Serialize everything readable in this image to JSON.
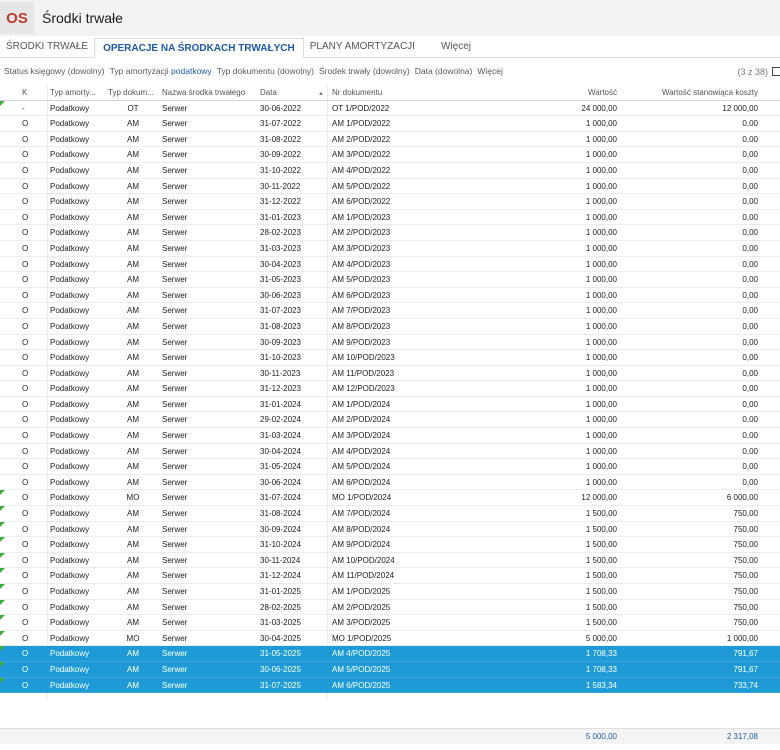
{
  "app": {
    "badge": "OS",
    "title": "Środki trwałe"
  },
  "tabs": [
    {
      "label": "ŚRODKI TRWAŁE",
      "active": false
    },
    {
      "label": "OPERACJE NA ŚRODKACH TRWAŁYCH",
      "active": true
    },
    {
      "label": "PLANY AMORTYZACJI",
      "active": false
    }
  ],
  "tabs_more": "Więcej",
  "filters": [
    {
      "label": "Status księgowy (dowolny)",
      "value": ""
    },
    {
      "label": "Typ amortyzacji ",
      "value": "podatkowy"
    },
    {
      "label": "Typ dokumentu (dowolny)",
      "value": ""
    },
    {
      "label": "Środek trwały (dowolny)",
      "value": ""
    },
    {
      "label": "Data (dowolna)",
      "value": ""
    },
    {
      "label": "Więcej",
      "value": ""
    }
  ],
  "record_count": "(3 z 38)",
  "columns": {
    "k": "K",
    "typ_amortyzacji": "Typ amorty...",
    "typ_dokumentu": "Typ dokum...",
    "nazwa": "Nazwa środka trwałego",
    "data": "Data",
    "nr": "Nr dokumentu",
    "wartosc": "Wartość",
    "wartosc_koszty": "Wartość stanowiąca koszty"
  },
  "rows": [
    {
      "k": "-",
      "ta": "Podatkowy",
      "td": "OT",
      "nz": "Serwer",
      "dt": "30-06-2022",
      "nr": "OT 1/POD/2022",
      "wa": "24 000,00",
      "wk": "12 000,00",
      "mark": true,
      "sel": false
    },
    {
      "k": "O",
      "ta": "Podatkowy",
      "td": "AM",
      "nz": "Serwer",
      "dt": "31-07-2022",
      "nr": "AM 1/POD/2022",
      "wa": "1 000,00",
      "wk": "0,00",
      "mark": false,
      "sel": false
    },
    {
      "k": "O",
      "ta": "Podatkowy",
      "td": "AM",
      "nz": "Serwer",
      "dt": "31-08-2022",
      "nr": "AM 2/POD/2022",
      "wa": "1 000,00",
      "wk": "0,00",
      "mark": false,
      "sel": false
    },
    {
      "k": "O",
      "ta": "Podatkowy",
      "td": "AM",
      "nz": "Serwer",
      "dt": "30-09-2022",
      "nr": "AM 3/POD/2022",
      "wa": "1 000,00",
      "wk": "0,00",
      "mark": false,
      "sel": false
    },
    {
      "k": "O",
      "ta": "Podatkowy",
      "td": "AM",
      "nz": "Serwer",
      "dt": "31-10-2022",
      "nr": "AM 4/POD/2022",
      "wa": "1 000,00",
      "wk": "0,00",
      "mark": false,
      "sel": false
    },
    {
      "k": "O",
      "ta": "Podatkowy",
      "td": "AM",
      "nz": "Serwer",
      "dt": "30-11-2022",
      "nr": "AM 5/POD/2022",
      "wa": "1 000,00",
      "wk": "0,00",
      "mark": false,
      "sel": false
    },
    {
      "k": "O",
      "ta": "Podatkowy",
      "td": "AM",
      "nz": "Serwer",
      "dt": "31-12-2022",
      "nr": "AM 6/POD/2022",
      "wa": "1 000,00",
      "wk": "0,00",
      "mark": false,
      "sel": false
    },
    {
      "k": "O",
      "ta": "Podatkowy",
      "td": "AM",
      "nz": "Serwer",
      "dt": "31-01-2023",
      "nr": "AM 1/POD/2023",
      "wa": "1 000,00",
      "wk": "0,00",
      "mark": false,
      "sel": false
    },
    {
      "k": "O",
      "ta": "Podatkowy",
      "td": "AM",
      "nz": "Serwer",
      "dt": "28-02-2023",
      "nr": "AM 2/POD/2023",
      "wa": "1 000,00",
      "wk": "0,00",
      "mark": false,
      "sel": false
    },
    {
      "k": "O",
      "ta": "Podatkowy",
      "td": "AM",
      "nz": "Serwer",
      "dt": "31-03-2023",
      "nr": "AM 3/POD/2023",
      "wa": "1 000,00",
      "wk": "0,00",
      "mark": false,
      "sel": false
    },
    {
      "k": "O",
      "ta": "Podatkowy",
      "td": "AM",
      "nz": "Serwer",
      "dt": "30-04-2023",
      "nr": "AM 4/POD/2023",
      "wa": "1 000,00",
      "wk": "0,00",
      "mark": false,
      "sel": false
    },
    {
      "k": "O",
      "ta": "Podatkowy",
      "td": "AM",
      "nz": "Serwer",
      "dt": "31-05-2023",
      "nr": "AM 5/POD/2023",
      "wa": "1 000,00",
      "wk": "0,00",
      "mark": false,
      "sel": false
    },
    {
      "k": "O",
      "ta": "Podatkowy",
      "td": "AM",
      "nz": "Serwer",
      "dt": "30-06-2023",
      "nr": "AM 6/POD/2023",
      "wa": "1 000,00",
      "wk": "0,00",
      "mark": false,
      "sel": false
    },
    {
      "k": "O",
      "ta": "Podatkowy",
      "td": "AM",
      "nz": "Serwer",
      "dt": "31-07-2023",
      "nr": "AM 7/POD/2023",
      "wa": "1 000,00",
      "wk": "0,00",
      "mark": false,
      "sel": false
    },
    {
      "k": "O",
      "ta": "Podatkowy",
      "td": "AM",
      "nz": "Serwer",
      "dt": "31-08-2023",
      "nr": "AM 8/POD/2023",
      "wa": "1 000,00",
      "wk": "0,00",
      "mark": false,
      "sel": false
    },
    {
      "k": "O",
      "ta": "Podatkowy",
      "td": "AM",
      "nz": "Serwer",
      "dt": "30-09-2023",
      "nr": "AM 9/POD/2023",
      "wa": "1 000,00",
      "wk": "0,00",
      "mark": false,
      "sel": false
    },
    {
      "k": "O",
      "ta": "Podatkowy",
      "td": "AM",
      "nz": "Serwer",
      "dt": "31-10-2023",
      "nr": "AM 10/POD/2023",
      "wa": "1 000,00",
      "wk": "0,00",
      "mark": false,
      "sel": false
    },
    {
      "k": "O",
      "ta": "Podatkowy",
      "td": "AM",
      "nz": "Serwer",
      "dt": "30-11-2023",
      "nr": "AM 11/POD/2023",
      "wa": "1 000,00",
      "wk": "0,00",
      "mark": false,
      "sel": false
    },
    {
      "k": "O",
      "ta": "Podatkowy",
      "td": "AM",
      "nz": "Serwer",
      "dt": "31-12-2023",
      "nr": "AM 12/POD/2023",
      "wa": "1 000,00",
      "wk": "0,00",
      "mark": false,
      "sel": false
    },
    {
      "k": "O",
      "ta": "Podatkowy",
      "td": "AM",
      "nz": "Serwer",
      "dt": "31-01-2024",
      "nr": "AM 1/POD/2024",
      "wa": "1 000,00",
      "wk": "0,00",
      "mark": false,
      "sel": false
    },
    {
      "k": "O",
      "ta": "Podatkowy",
      "td": "AM",
      "nz": "Serwer",
      "dt": "29-02-2024",
      "nr": "AM 2/POD/2024",
      "wa": "1 000,00",
      "wk": "0,00",
      "mark": false,
      "sel": false
    },
    {
      "k": "O",
      "ta": "Podatkowy",
      "td": "AM",
      "nz": "Serwer",
      "dt": "31-03-2024",
      "nr": "AM 3/POD/2024",
      "wa": "1 000,00",
      "wk": "0,00",
      "mark": false,
      "sel": false
    },
    {
      "k": "O",
      "ta": "Podatkowy",
      "td": "AM",
      "nz": "Serwer",
      "dt": "30-04-2024",
      "nr": "AM 4/POD/2024",
      "wa": "1 000,00",
      "wk": "0,00",
      "mark": false,
      "sel": false
    },
    {
      "k": "O",
      "ta": "Podatkowy",
      "td": "AM",
      "nz": "Serwer",
      "dt": "31-05-2024",
      "nr": "AM 5/POD/2024",
      "wa": "1 000,00",
      "wk": "0,00",
      "mark": false,
      "sel": false
    },
    {
      "k": "O",
      "ta": "Podatkowy",
      "td": "AM",
      "nz": "Serwer",
      "dt": "30-06-2024",
      "nr": "AM 6/POD/2024",
      "wa": "1 000,00",
      "wk": "0,00",
      "mark": false,
      "sel": false
    },
    {
      "k": "O",
      "ta": "Podatkowy",
      "td": "MO",
      "nz": "Serwer",
      "dt": "31-07-2024",
      "nr": "MO 1/POD/2024",
      "wa": "12 000,00",
      "wk": "6 000,00",
      "mark": true,
      "sel": false
    },
    {
      "k": "O",
      "ta": "Podatkowy",
      "td": "AM",
      "nz": "Serwer",
      "dt": "31-08-2024",
      "nr": "AM 7/POD/2024",
      "wa": "1 500,00",
      "wk": "750,00",
      "mark": true,
      "sel": false
    },
    {
      "k": "O",
      "ta": "Podatkowy",
      "td": "AM",
      "nz": "Serwer",
      "dt": "30-09-2024",
      "nr": "AM 8/POD/2024",
      "wa": "1 500,00",
      "wk": "750,00",
      "mark": true,
      "sel": false
    },
    {
      "k": "O",
      "ta": "Podatkowy",
      "td": "AM",
      "nz": "Serwer",
      "dt": "31-10-2024",
      "nr": "AM 9/POD/2024",
      "wa": "1 500,00",
      "wk": "750,00",
      "mark": true,
      "sel": false
    },
    {
      "k": "O",
      "ta": "Podatkowy",
      "td": "AM",
      "nz": "Serwer",
      "dt": "30-11-2024",
      "nr": "AM 10/POD/2024",
      "wa": "1 500,00",
      "wk": "750,00",
      "mark": true,
      "sel": false
    },
    {
      "k": "O",
      "ta": "Podatkowy",
      "td": "AM",
      "nz": "Serwer",
      "dt": "31-12-2024",
      "nr": "AM 11/POD/2024",
      "wa": "1 500,00",
      "wk": "750,00",
      "mark": true,
      "sel": false
    },
    {
      "k": "O",
      "ta": "Podatkowy",
      "td": "AM",
      "nz": "Serwer",
      "dt": "31-01-2025",
      "nr": "AM 1/POD/2025",
      "wa": "1 500,00",
      "wk": "750,00",
      "mark": true,
      "sel": false
    },
    {
      "k": "O",
      "ta": "Podatkowy",
      "td": "AM",
      "nz": "Serwer",
      "dt": "28-02-2025",
      "nr": "AM 2/POD/2025",
      "wa": "1 500,00",
      "wk": "750,00",
      "mark": true,
      "sel": false
    },
    {
      "k": "O",
      "ta": "Podatkowy",
      "td": "AM",
      "nz": "Serwer",
      "dt": "31-03-2025",
      "nr": "AM 3/POD/2025",
      "wa": "1 500,00",
      "wk": "750,00",
      "mark": true,
      "sel": false
    },
    {
      "k": "O",
      "ta": "Podatkowy",
      "td": "MO",
      "nz": "Serwer",
      "dt": "30-04-2025",
      "nr": "MO 1/POD/2025",
      "wa": "5 000,00",
      "wk": "1 000,00",
      "mark": true,
      "sel": false
    },
    {
      "k": "O",
      "ta": "Podatkowy",
      "td": "AM",
      "nz": "Serwer",
      "dt": "31-05-2025",
      "nr": "AM 4/POD/2025",
      "wa": "1 708,33",
      "wk": "791,67",
      "mark": true,
      "sel": true
    },
    {
      "k": "O",
      "ta": "Podatkowy",
      "td": "AM",
      "nz": "Serwer",
      "dt": "30-06-2025",
      "nr": "AM 5/POD/2025",
      "wa": "1 708,33",
      "wk": "791,67",
      "mark": true,
      "sel": true
    },
    {
      "k": "O",
      "ta": "Podatkowy",
      "td": "AM",
      "nz": "Serwer",
      "dt": "31-07-2025",
      "nr": "AM 6/POD/2025",
      "wa": "1 583,34",
      "wk": "733,74",
      "mark": true,
      "sel": true
    }
  ],
  "totals": {
    "wartosc": "5 000,00",
    "wartosc_koszty": "2 317,08"
  }
}
